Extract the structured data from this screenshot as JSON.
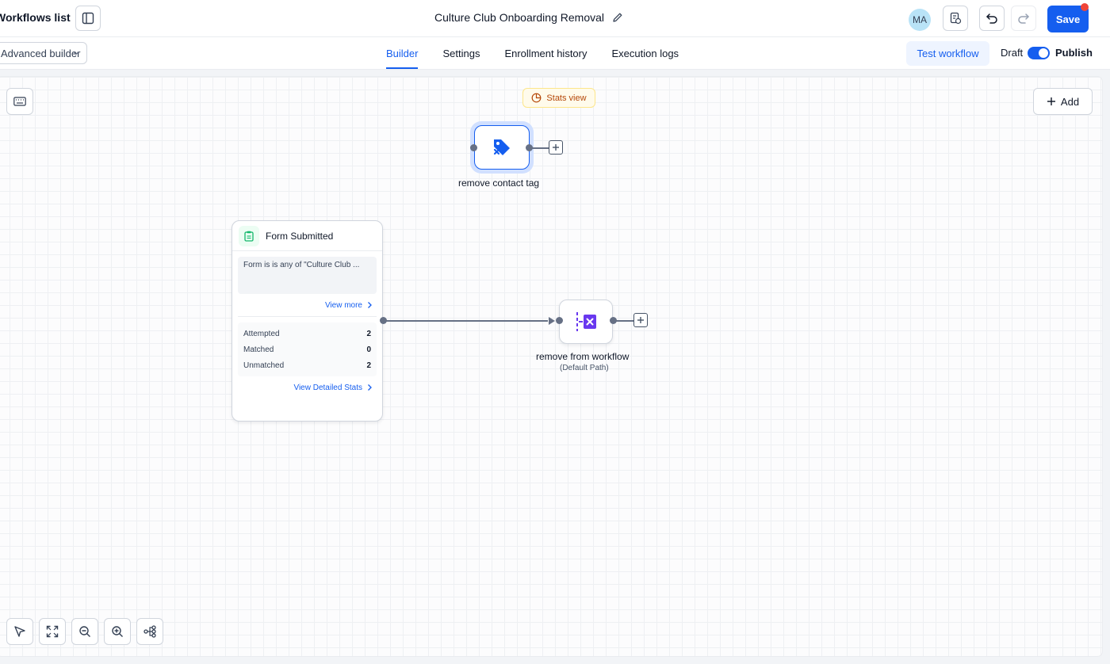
{
  "header": {
    "back_label": "Workflows list",
    "title": "Culture Club Onboarding Removal",
    "avatar_initials": "MA",
    "save_label": "Save"
  },
  "subbar": {
    "builder_mode": "Advanced builder",
    "tabs": [
      {
        "label": "Builder",
        "active": true
      },
      {
        "label": "Settings",
        "active": false
      },
      {
        "label": "Enrollment history",
        "active": false
      },
      {
        "label": "Execution logs",
        "active": false
      }
    ],
    "test_label": "Test workflow",
    "draft_label": "Draft",
    "publish_label": "Publish"
  },
  "canvas": {
    "stats_view_label": "Stats view",
    "add_label": "Add",
    "action_tag": {
      "label": "remove contact tag",
      "icon": "tag-remove-icon"
    },
    "trigger": {
      "title": "Form Submitted",
      "condition": "Form is is any of \"Culture Club ...",
      "view_more": "View more",
      "stats": [
        {
          "label": "Attempted",
          "value": "2"
        },
        {
          "label": "Matched",
          "value": "0"
        },
        {
          "label": "Unmatched",
          "value": "2"
        }
      ],
      "detailed_link": "View Detailed Stats"
    },
    "action_remove": {
      "label": "remove from workflow",
      "sublabel": "(Default Path)",
      "icon": "remove-workflow-icon"
    }
  },
  "colors": {
    "primary": "#155eef",
    "accent_purple": "#6938ef",
    "notification": "#f04438",
    "stats_amber": "#b54708"
  }
}
